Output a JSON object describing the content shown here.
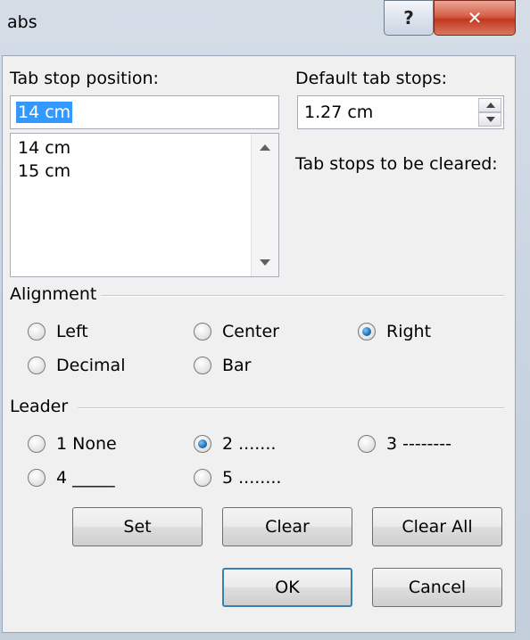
{
  "window": {
    "title": "abs"
  },
  "caption_buttons": {
    "help_label": "?",
    "close_label": "✕"
  },
  "tab_stop_position": {
    "label": "Tab stop position:",
    "value": "14 cm",
    "list": [
      "14 cm",
      "15 cm"
    ]
  },
  "default_tab_stops": {
    "label": "Default tab stops:",
    "value": "1.27 cm"
  },
  "tab_stops_cleared": {
    "label": "Tab stops to be cleared:"
  },
  "alignment": {
    "label": "Alignment",
    "options": [
      {
        "label": "Left",
        "selected": false
      },
      {
        "label": "Center",
        "selected": false
      },
      {
        "label": "Right",
        "selected": true
      },
      {
        "label": "Decimal",
        "selected": false
      },
      {
        "label": "Bar",
        "selected": false
      }
    ]
  },
  "leader": {
    "label": "Leader",
    "options": [
      {
        "label": "1 None",
        "selected": false
      },
      {
        "label": "2 .......",
        "selected": true
      },
      {
        "label": "3 --------",
        "selected": false
      },
      {
        "label": "4 _____",
        "selected": false
      },
      {
        "label": "5 ........",
        "selected": false
      }
    ]
  },
  "buttons": {
    "set": "Set",
    "clear": "Clear",
    "clear_all": "Clear All",
    "ok": "OK",
    "cancel": "Cancel"
  }
}
